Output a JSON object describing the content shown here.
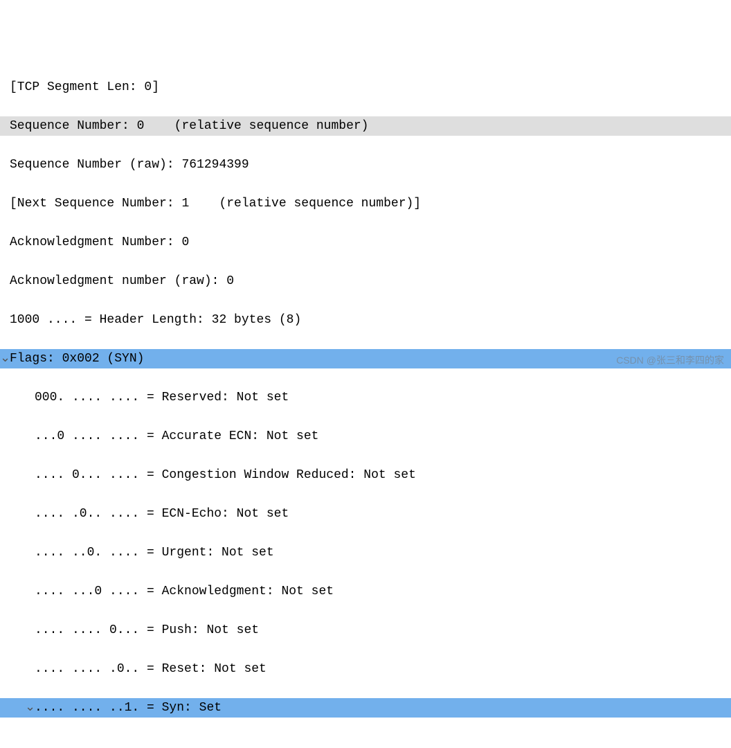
{
  "fields": {
    "tcp_segment_len": "[TCP Segment Len: 0]",
    "seq_rel": "Sequence Number: 0    (relative sequence number)",
    "seq_raw": "Sequence Number (raw): 761294399",
    "next_seq": "[Next Sequence Number: 1    (relative sequence number)]",
    "ack_num": "Acknowledgment Number: 0",
    "ack_raw": "Acknowledgment number (raw): 0",
    "hdr_len": "1000 .... = Header Length: 32 bytes (8)",
    "flags": "Flags: 0x002 (SYN)",
    "reserved": "000. .... .... = Reserved: Not set",
    "acc_ecn": "...0 .... .... = Accurate ECN: Not set",
    "cwr": ".... 0... .... = Congestion Window Reduced: Not set",
    "ecn_echo": ".... .0.. .... = ECN-Echo: Not set",
    "urgent": ".... ..0. .... = Urgent: Not set",
    "ack": ".... ...0 .... = Acknowledgment: Not set",
    "push": ".... .... 0... = Push: Not set",
    "reset": ".... .... .0.. = Reset: Not set",
    "syn": ".... .... ..1. = Syn: Set"
  },
  "expander_open": "⌄",
  "watermark": "CSDN @张三和李四的家"
}
